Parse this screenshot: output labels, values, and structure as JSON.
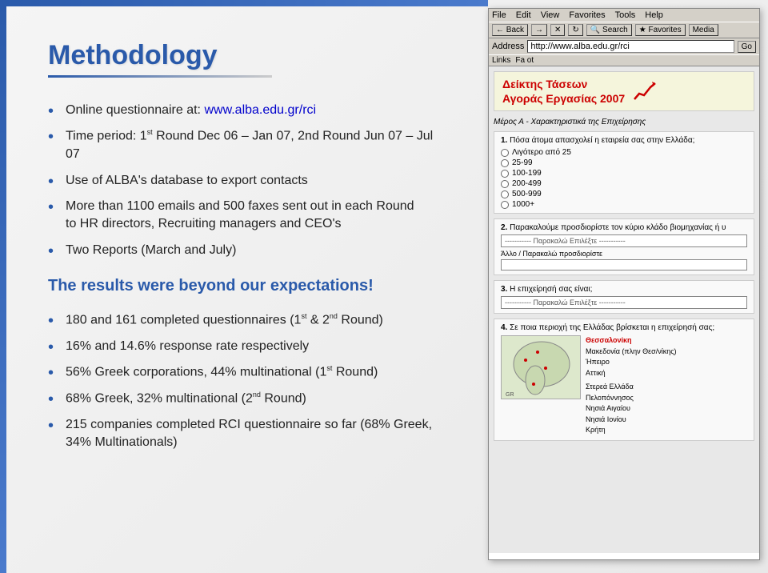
{
  "slide": {
    "title": "Methodology",
    "browser": {
      "menubar": [
        "File",
        "Edit",
        "View",
        "Favorites",
        "Tools",
        "Help"
      ],
      "nav_buttons": [
        "← Back",
        "→",
        "✕",
        "🔄"
      ],
      "address_label": "Address",
      "address_value": "http://www.alba.edu.gr/rci",
      "links_toolbar": "Fa ot",
      "greek_title_line1": "Δείκτης Τάσεων",
      "greek_title_line2": "Αγοράς Εργασίας 2007",
      "section_label": "Μέρος Α - Χαρακτηριστικά της Επιχείρησης",
      "q1_text": "Πόσα άτομα απασχολεί η εταιρεία σας στην Ελλάδα;",
      "q1_options": [
        "Λιγότερο από 25",
        "25-99",
        "100-199",
        "200-499",
        "500-999",
        "1000+"
      ],
      "q2_text": "Παρακαλούμε προσδιορίστε τον κύριο κλάδο βιομηχανίας ή υ",
      "q2_dropdown": "----------- Παρακαλώ Επιλέξτε -----------",
      "q2_other": "Άλλο / Παρακαλώ προσδιορίστε",
      "q3_text": "Η επιχείρησή σας είναι;",
      "q3_dropdown": "----------- Παρακαλώ Επιλέξτε -----------",
      "q4_text": "Σε ποια περιοχή της Ελλάδας βρίσκεται η επιχείρησή σας;",
      "map_regions_left": [
        "Θεσσαλονίκη",
        "Μακεδονία (πλην Θεσ/νίκης)",
        "Ήπειρο",
        "Αττική"
      ],
      "map_regions_right": [
        "Στερεά Ελλάδα",
        "Πελοπόννησος",
        "Νησιά Αιγαίου",
        "Νησιά Ιονίου",
        "Κρήτη"
      ]
    },
    "bullet_points": [
      {
        "text": "Online questionnaire at: ",
        "link": "www.alba.edu.gr/rci"
      },
      {
        "text": "Time period: 1st Round Dec 06 – Jan 07, 2nd Round Jun 07 – Jul 07"
      },
      {
        "text": "Use of ALBA's database to export contacts"
      },
      {
        "text": "More than 1100 emails and 500 faxes sent out in each Round to HR directors, Recruiting managers and CEO's"
      },
      {
        "text": "Two Reports (March and July)"
      }
    ],
    "results_heading": "The results were beyond our expectations!",
    "results_bullets": [
      {
        "text": "180 and 161 completed questionnaires (1st & 2nd Round)"
      },
      {
        "text": "16% and 14.6% response rate respectively"
      },
      {
        "text": "56% Greek corporations, 44% multinational (1st Round)"
      },
      {
        "text": "68% Greek, 32% multinational (2nd Round)"
      },
      {
        "text": "215 companies completed RCI questionnaire so far (68% Greek, 34% Multinationals)"
      }
    ]
  }
}
